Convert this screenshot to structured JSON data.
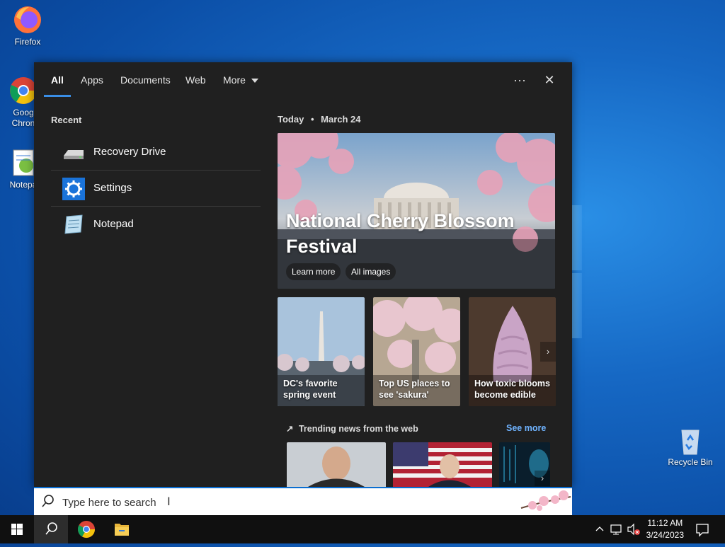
{
  "desktop": {
    "icons": [
      {
        "label": "Firefox",
        "icon": "firefox-icon"
      },
      {
        "label": "Goog\nChron",
        "icon": "chrome-icon"
      },
      {
        "label": "Notepa",
        "icon": "notepad-icon"
      },
      {
        "label": "Recycle Bin",
        "icon": "recycle-bin-icon"
      }
    ]
  },
  "search_panel": {
    "tabs": [
      {
        "label": "All"
      },
      {
        "label": "Apps"
      },
      {
        "label": "Documents"
      },
      {
        "label": "Web"
      },
      {
        "label": "More"
      }
    ],
    "controls": {
      "more_options": "···",
      "close": "✕"
    },
    "recent": {
      "title": "Recent",
      "items": [
        {
          "label": "Recovery Drive",
          "icon": "drive-icon"
        },
        {
          "label": "Settings",
          "icon": "gear-icon"
        },
        {
          "label": "Notepad",
          "icon": "notepad-icon"
        }
      ]
    },
    "today": {
      "label": "Today",
      "separator": "•",
      "date": "March 24",
      "hero": {
        "title": "National Cherry Blossom Festival",
        "buttons": [
          "Learn more",
          "All images"
        ]
      },
      "cards": [
        {
          "label": "DC's favorite spring event"
        },
        {
          "label": "Top US places to see 'sakura'"
        },
        {
          "label": "How toxic blooms become edible"
        }
      ]
    },
    "trending": {
      "title": "Trending news from the web",
      "see_more": "See more"
    }
  },
  "searchbox": {
    "placeholder": "Type here to search"
  },
  "taskbar": {
    "time": "11:12 AM",
    "date": "3/24/2023",
    "accent": "#0a6ed1"
  }
}
